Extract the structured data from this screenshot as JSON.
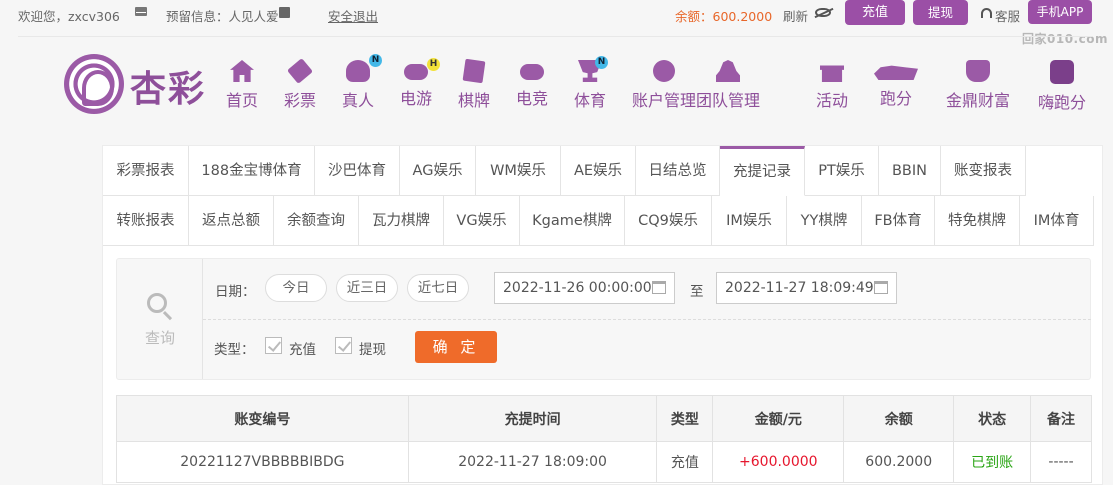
{
  "topbar": {
    "welcome": "欢迎您，zxcv306",
    "notice": "预留信息：人见人爱",
    "logout": "安全退出",
    "balance": "余额：600.2000",
    "refresh": "刷新",
    "deposit": "充值",
    "withdraw": "提现",
    "service": "客服",
    "app": "手机APP"
  },
  "watermark": "回家010.com",
  "logo_text": "杏彩",
  "nav": [
    {
      "label": "首页",
      "icon": "home-icon"
    },
    {
      "label": "彩票",
      "icon": "lottery-ticket-icon"
    },
    {
      "label": "真人",
      "icon": "live-dealer-icon",
      "badge": "N"
    },
    {
      "label": "电游",
      "icon": "gamepad-icon",
      "badge": "H"
    },
    {
      "label": "棋牌",
      "icon": "cards-icon"
    },
    {
      "label": "电竞",
      "icon": "controller-icon"
    },
    {
      "label": "体育",
      "icon": "trophy-icon",
      "badge": "N"
    },
    {
      "label": "账户管理",
      "icon": "yen-coin-icon"
    },
    {
      "label": "团队管理",
      "icon": "team-icon"
    },
    {
      "label": "活动",
      "icon": "gift-icon"
    },
    {
      "label": "跑分",
      "icon": "rhino-icon"
    },
    {
      "label": "金鼎财富",
      "icon": "ding-icon"
    },
    {
      "label": "嗨跑分",
      "icon": "hi-icon"
    }
  ],
  "tabs_row1": [
    "彩票报表",
    "188金宝博体育",
    "沙巴体育",
    "AG娱乐",
    "WM娱乐",
    "AE娱乐",
    "日结总览",
    "充提记录",
    "PT娱乐",
    "BBIN",
    "账变报表"
  ],
  "tabs_row2": [
    "转账报表",
    "返点总额",
    "余额查询",
    "瓦力棋牌",
    "VG娱乐",
    "Kgame棋牌",
    "CQ9娱乐",
    "IM娱乐",
    "YY棋牌",
    "FB体育",
    "特免棋牌",
    "IM体育"
  ],
  "active_tab": "充提记录",
  "query": {
    "label": "查询",
    "date_label": "日期：",
    "today": "今日",
    "three_days": "近三日",
    "seven_days": "近七日",
    "start": "2022-11-26 00:00:00",
    "to": "至",
    "end": "2022-11-27 18:09:49",
    "type_label": "类型：",
    "type_deposit": "充值",
    "type_withdraw": "提现",
    "confirm": "确 定"
  },
  "table": {
    "headers": [
      "账变编号",
      "充提时间",
      "类型",
      "金额/元",
      "余额",
      "状态",
      "备注"
    ],
    "rows": [
      [
        "20221127VBBBBBIBDG",
        "2022-11-27 18:09:00",
        "充值",
        "+600.0000",
        "600.2000",
        "已到账",
        "-----"
      ]
    ]
  },
  "colors": {
    "accent": "#9b5aa6",
    "balance": "#e8672a",
    "confirm": "#ef6b2a",
    "amount": "#e6162d",
    "status_ok": "#2aa515"
  }
}
